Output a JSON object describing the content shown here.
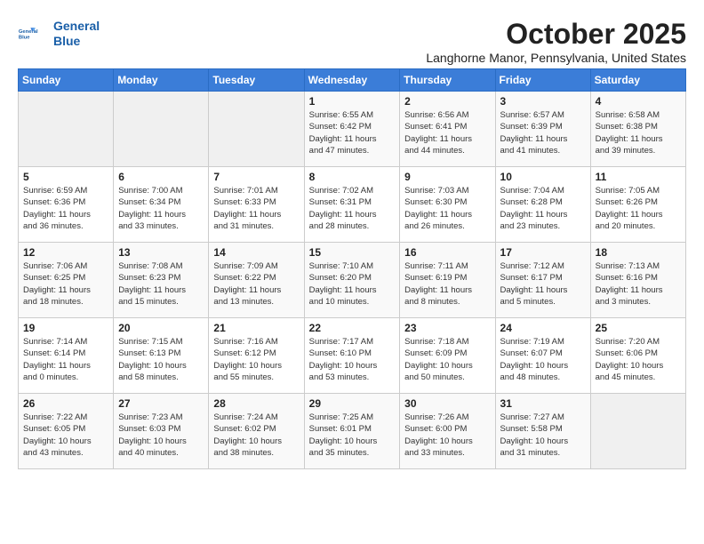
{
  "header": {
    "logo_line1": "General",
    "logo_line2": "Blue",
    "title": "October 2025",
    "subtitle": "Langhorne Manor, Pennsylvania, United States"
  },
  "days_of_week": [
    "Sunday",
    "Monday",
    "Tuesday",
    "Wednesday",
    "Thursday",
    "Friday",
    "Saturday"
  ],
  "weeks": [
    [
      {
        "day": "",
        "info": ""
      },
      {
        "day": "",
        "info": ""
      },
      {
        "day": "",
        "info": ""
      },
      {
        "day": "1",
        "info": "Sunrise: 6:55 AM\nSunset: 6:42 PM\nDaylight: 11 hours\nand 47 minutes."
      },
      {
        "day": "2",
        "info": "Sunrise: 6:56 AM\nSunset: 6:41 PM\nDaylight: 11 hours\nand 44 minutes."
      },
      {
        "day": "3",
        "info": "Sunrise: 6:57 AM\nSunset: 6:39 PM\nDaylight: 11 hours\nand 41 minutes."
      },
      {
        "day": "4",
        "info": "Sunrise: 6:58 AM\nSunset: 6:38 PM\nDaylight: 11 hours\nand 39 minutes."
      }
    ],
    [
      {
        "day": "5",
        "info": "Sunrise: 6:59 AM\nSunset: 6:36 PM\nDaylight: 11 hours\nand 36 minutes."
      },
      {
        "day": "6",
        "info": "Sunrise: 7:00 AM\nSunset: 6:34 PM\nDaylight: 11 hours\nand 33 minutes."
      },
      {
        "day": "7",
        "info": "Sunrise: 7:01 AM\nSunset: 6:33 PM\nDaylight: 11 hours\nand 31 minutes."
      },
      {
        "day": "8",
        "info": "Sunrise: 7:02 AM\nSunset: 6:31 PM\nDaylight: 11 hours\nand 28 minutes."
      },
      {
        "day": "9",
        "info": "Sunrise: 7:03 AM\nSunset: 6:30 PM\nDaylight: 11 hours\nand 26 minutes."
      },
      {
        "day": "10",
        "info": "Sunrise: 7:04 AM\nSunset: 6:28 PM\nDaylight: 11 hours\nand 23 minutes."
      },
      {
        "day": "11",
        "info": "Sunrise: 7:05 AM\nSunset: 6:26 PM\nDaylight: 11 hours\nand 20 minutes."
      }
    ],
    [
      {
        "day": "12",
        "info": "Sunrise: 7:06 AM\nSunset: 6:25 PM\nDaylight: 11 hours\nand 18 minutes."
      },
      {
        "day": "13",
        "info": "Sunrise: 7:08 AM\nSunset: 6:23 PM\nDaylight: 11 hours\nand 15 minutes."
      },
      {
        "day": "14",
        "info": "Sunrise: 7:09 AM\nSunset: 6:22 PM\nDaylight: 11 hours\nand 13 minutes."
      },
      {
        "day": "15",
        "info": "Sunrise: 7:10 AM\nSunset: 6:20 PM\nDaylight: 11 hours\nand 10 minutes."
      },
      {
        "day": "16",
        "info": "Sunrise: 7:11 AM\nSunset: 6:19 PM\nDaylight: 11 hours\nand 8 minutes."
      },
      {
        "day": "17",
        "info": "Sunrise: 7:12 AM\nSunset: 6:17 PM\nDaylight: 11 hours\nand 5 minutes."
      },
      {
        "day": "18",
        "info": "Sunrise: 7:13 AM\nSunset: 6:16 PM\nDaylight: 11 hours\nand 3 minutes."
      }
    ],
    [
      {
        "day": "19",
        "info": "Sunrise: 7:14 AM\nSunset: 6:14 PM\nDaylight: 11 hours\nand 0 minutes."
      },
      {
        "day": "20",
        "info": "Sunrise: 7:15 AM\nSunset: 6:13 PM\nDaylight: 10 hours\nand 58 minutes."
      },
      {
        "day": "21",
        "info": "Sunrise: 7:16 AM\nSunset: 6:12 PM\nDaylight: 10 hours\nand 55 minutes."
      },
      {
        "day": "22",
        "info": "Sunrise: 7:17 AM\nSunset: 6:10 PM\nDaylight: 10 hours\nand 53 minutes."
      },
      {
        "day": "23",
        "info": "Sunrise: 7:18 AM\nSunset: 6:09 PM\nDaylight: 10 hours\nand 50 minutes."
      },
      {
        "day": "24",
        "info": "Sunrise: 7:19 AM\nSunset: 6:07 PM\nDaylight: 10 hours\nand 48 minutes."
      },
      {
        "day": "25",
        "info": "Sunrise: 7:20 AM\nSunset: 6:06 PM\nDaylight: 10 hours\nand 45 minutes."
      }
    ],
    [
      {
        "day": "26",
        "info": "Sunrise: 7:22 AM\nSunset: 6:05 PM\nDaylight: 10 hours\nand 43 minutes."
      },
      {
        "day": "27",
        "info": "Sunrise: 7:23 AM\nSunset: 6:03 PM\nDaylight: 10 hours\nand 40 minutes."
      },
      {
        "day": "28",
        "info": "Sunrise: 7:24 AM\nSunset: 6:02 PM\nDaylight: 10 hours\nand 38 minutes."
      },
      {
        "day": "29",
        "info": "Sunrise: 7:25 AM\nSunset: 6:01 PM\nDaylight: 10 hours\nand 35 minutes."
      },
      {
        "day": "30",
        "info": "Sunrise: 7:26 AM\nSunset: 6:00 PM\nDaylight: 10 hours\nand 33 minutes."
      },
      {
        "day": "31",
        "info": "Sunrise: 7:27 AM\nSunset: 5:58 PM\nDaylight: 10 hours\nand 31 minutes."
      },
      {
        "day": "",
        "info": ""
      }
    ]
  ]
}
